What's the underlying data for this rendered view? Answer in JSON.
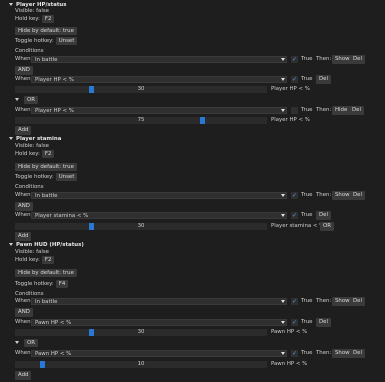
{
  "sections": [
    {
      "title": "Player HP/status",
      "visible": "Visible: false",
      "hold_key_label": "Hold key:",
      "hold_key": "F2",
      "hide_default": "Hide by default: true",
      "toggle_label": "Toggle hotkey:",
      "toggle_key": "Unset"
    },
    {
      "title": "Player stamina",
      "visible": "Visible: false",
      "hold_key_label": "Hold key:",
      "hold_key": "F2",
      "hide_default": "Hide by default: true",
      "toggle_label": "Toggle hotkey:",
      "toggle_key": "Unset"
    },
    {
      "title": "Pawn HUD (HP/status)",
      "visible": "Visible: false",
      "hold_key_label": "Hold key:",
      "hold_key": "F2",
      "hide_default": "Hide by default: true",
      "toggle_label": "Toggle hotkey:",
      "toggle_key": "F4"
    }
  ],
  "common": {
    "conditions": "Conditions",
    "when": "When",
    "and": "AND",
    "or": "OR",
    "true": "True",
    "then": "Then:",
    "show": "Show",
    "hide": "Hide",
    "del": "Del",
    "add": "Add",
    "in_battle": "In battle",
    "player_hp": "Player HP < %",
    "player_stamina": "Player stamina < %",
    "pawn_hp": "Pawn HP < %"
  },
  "sliders": {
    "s1": {
      "value": "30",
      "fraction": 0.3,
      "label": "Player HP < %"
    },
    "s2": {
      "value": "75",
      "fraction": 0.75,
      "label": "Player HP < %"
    },
    "s3": {
      "value": "30",
      "fraction": 0.3,
      "label": "Player stamina < %"
    },
    "s4": {
      "value": "30",
      "fraction": 0.3,
      "label": "Pawn HP < %"
    },
    "s5": {
      "value": "10",
      "fraction": 0.1,
      "label": "Pawn HP < %"
    }
  },
  "colors": {
    "background": "#1e1e1e",
    "accent": "#2a78d6",
    "button": "#3a3a3a"
  }
}
